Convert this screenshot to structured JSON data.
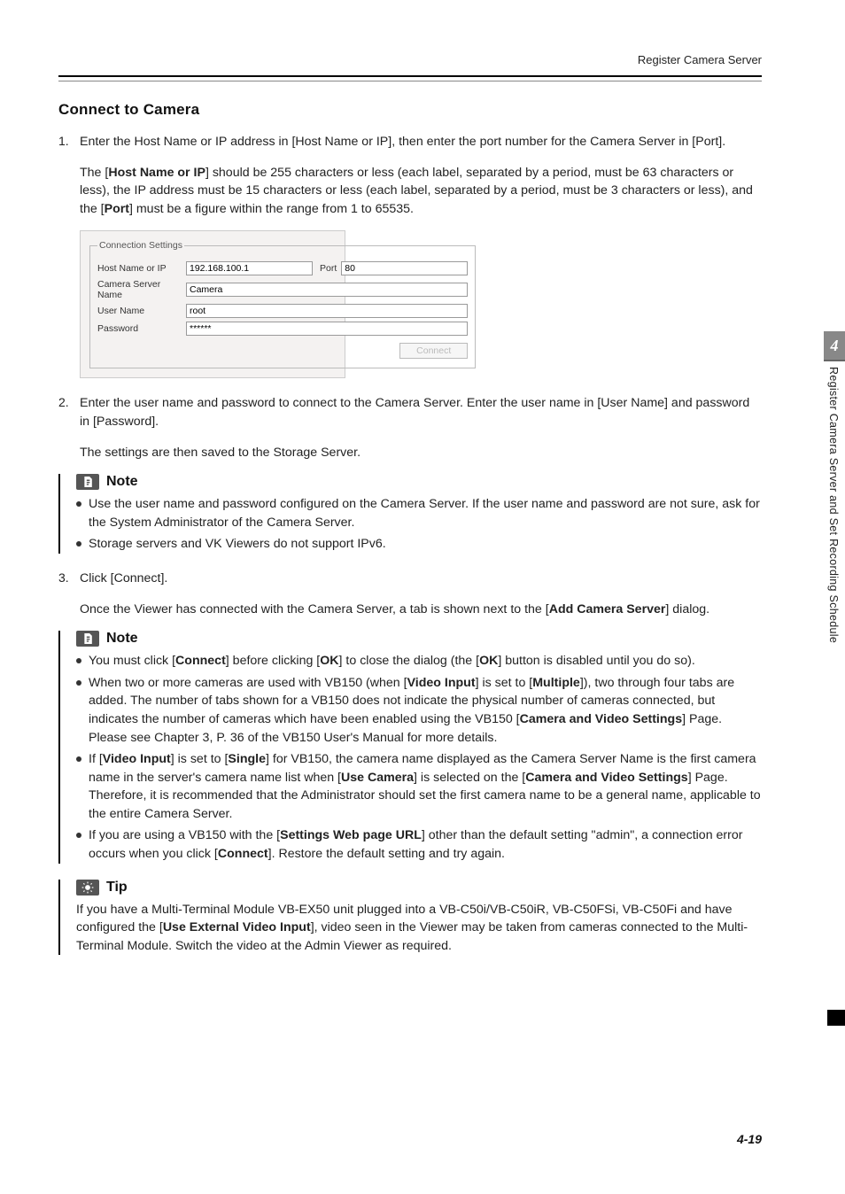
{
  "header": {
    "label": "Register Camera Server"
  },
  "section_title": "Connect to Camera",
  "step1": {
    "num": "1.",
    "text": "Enter the Host Name or IP address in [Host Name or IP], then enter the port number for the Camera Server in [Port].",
    "detail_pre": "The [",
    "host_bold": "Host Name or IP",
    "detail_mid": "] should be 255 characters or less (each label, separated by a period, must be 63 characters or less), the IP address must be 15 characters or less (each label, separated by a period, must be 3 characters or less), and the [",
    "port_bold": "Port",
    "detail_post": "] must be a figure within the range from 1 to 65535."
  },
  "screenshot": {
    "legend": "Connection Settings",
    "host_label": "Host Name or IP",
    "host_value": "192.168.100.1",
    "port_label": "Port",
    "port_value": "80",
    "server_label": "Camera Server Name",
    "server_value": "Camera",
    "user_label": "User Name",
    "user_value": "root",
    "pass_label": "Password",
    "pass_value": "******",
    "connect_btn": "Connect"
  },
  "step2": {
    "num": "2.",
    "text": "Enter the user name and password to connect to the Camera Server. Enter the user name in [User Name] and password in [Password].",
    "detail": "The settings are then saved to the Storage Server."
  },
  "note1": {
    "title": "Note",
    "items": [
      "Use the user name and password configured on the Camera Server. If the user name and password are not sure, ask for the System Administrator of the Camera Server.",
      "Storage servers and VK Viewers do not support IPv6."
    ]
  },
  "step3": {
    "num": "3.",
    "text": "Click [Connect].",
    "detail_pre": "Once the Viewer has connected with the Camera Server, a tab is shown next to the [",
    "bold": "Add Camera Server",
    "detail_post": "] dialog."
  },
  "note2": {
    "title": "Note",
    "i0_a": "You must click [",
    "i0_b": "Connect",
    "i0_c": "] before clicking [",
    "i0_d": "OK",
    "i0_e": "] to close the dialog (the [",
    "i0_f": "OK",
    "i0_g": "] button is disabled until you do so).",
    "i1_a": "When two or more cameras are used with VB150 (when [",
    "i1_b": "Video Input",
    "i1_c": "] is set to [",
    "i1_d": "Multiple",
    "i1_e": "]), two through four tabs are added. The number of tabs shown for a VB150 does not indicate the physical number of cameras connected, but indicates the number of cameras which have been enabled using the VB150 [",
    "i1_f": "Camera and Video Settings",
    "i1_g": "] Page. Please see Chapter 3, P. 36 of the VB150 User's Manual for more details.",
    "i2_a": "If [",
    "i2_b": "Video Input",
    "i2_c": "] is set to [",
    "i2_d": "Single",
    "i2_e": "] for VB150, the camera name displayed as the Camera Server Name is the first camera name in the server's camera name list when [",
    "i2_f": "Use Camera",
    "i2_g": "] is selected on the [",
    "i2_h": "Camera and Video Settings",
    "i2_i": "] Page. Therefore, it is recommended that the Administrator should set the first camera name to be a general name, applicable to the entire Camera Server.",
    "i3_a": "If you are using a VB150 with the [",
    "i3_b": "Settings Web page URL",
    "i3_c": "] other than the default setting \"admin\", a connection error occurs when you click [",
    "i3_d": "Connect",
    "i3_e": "]. Restore the default setting and try again."
  },
  "tip": {
    "title": "Tip",
    "a": "If you have a Multi-Terminal Module VB-EX50 unit plugged into a VB-C50i/VB-C50iR, VB-C50FSi, VB-C50Fi and have configured the [",
    "b": "Use External Video Input",
    "c": "], video seen in the Viewer may be taken from cameras connected to the Multi-Terminal Module. Switch the video at the Admin Viewer as required."
  },
  "side": {
    "chapter": "4",
    "text": "Register Camera Server and Set Recording Schedule"
  },
  "footer": "4-19"
}
